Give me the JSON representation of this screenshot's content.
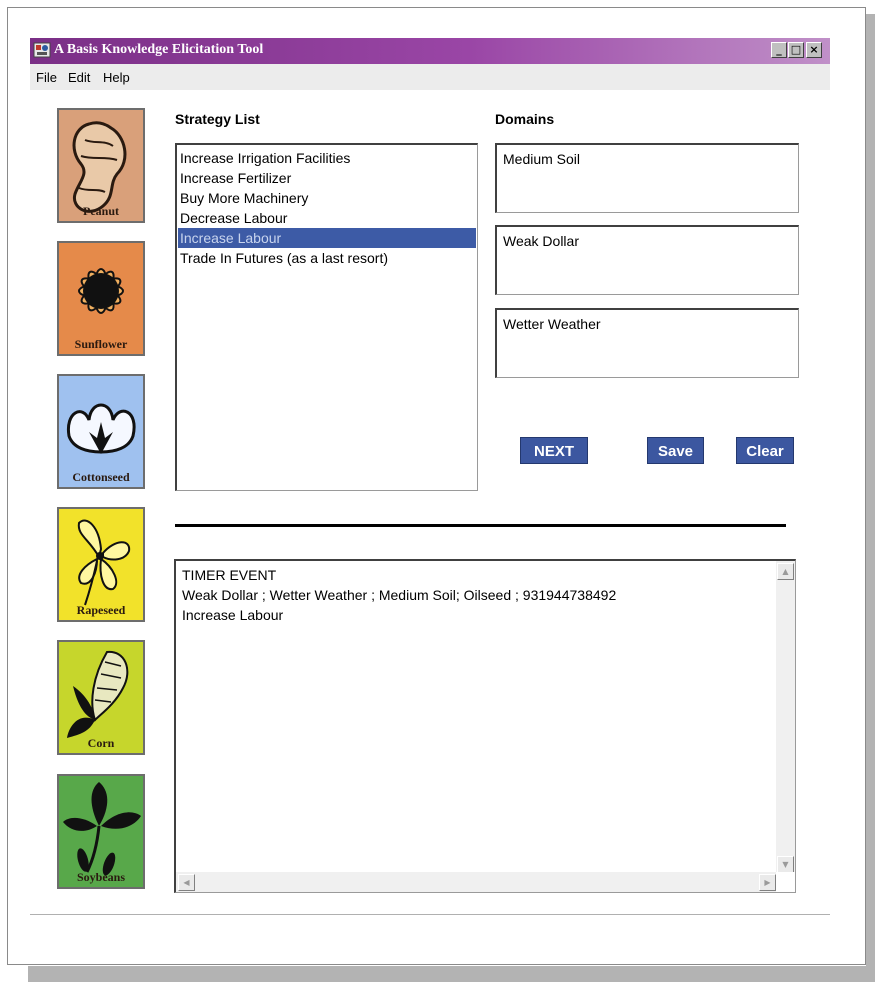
{
  "window": {
    "title": "A Basis Knowledge Elicitation Tool",
    "controls": [
      "minimize-icon",
      "maximize-icon",
      "close-icon"
    ]
  },
  "menu": {
    "items": [
      {
        "label": "File"
      },
      {
        "label": "Edit"
      },
      {
        "label": "Help"
      }
    ]
  },
  "crops": [
    {
      "label": "Peanut",
      "icon": "peanut-icon",
      "color": "#d9a07a"
    },
    {
      "label": "Sunflower",
      "icon": "sunflower-icon",
      "color": "#e58a4a"
    },
    {
      "label": "Cottonseed",
      "icon": "cottonseed-icon",
      "color": "#9fc1ef"
    },
    {
      "label": "Rapeseed",
      "icon": "rapeseed-icon",
      "color": "#f2e22a"
    },
    {
      "label": "Corn",
      "icon": "corn-icon",
      "color": "#c6d62c"
    },
    {
      "label": "Soybeans",
      "icon": "soybeans-icon",
      "color": "#58a84a"
    }
  ],
  "strategy": {
    "heading": "Strategy List",
    "items": [
      "Increase Irrigation Facilities",
      "Increase Fertilizer",
      "Buy More Machinery",
      "Decrease Labour",
      "Increase Labour",
      "Trade In Futures (as a last resort)"
    ],
    "selected_index": 4,
    "selection_color": "#3d5ba6"
  },
  "domains": {
    "heading": "Domains",
    "values": [
      "Medium Soil",
      "Weak Dollar",
      "Wetter Weather"
    ]
  },
  "buttons": {
    "next": "NEXT",
    "save": "Save",
    "clear": "Clear",
    "color": "#3c57a0"
  },
  "log": {
    "lines": [
      "TIMER EVENT",
      "Weak Dollar ; Wetter Weather ; Medium Soil; Oilseed ; 931944738492",
      "Increase Labour"
    ]
  },
  "colors": {
    "titlebar": "#7a2f86",
    "menubar": "#ececec"
  }
}
